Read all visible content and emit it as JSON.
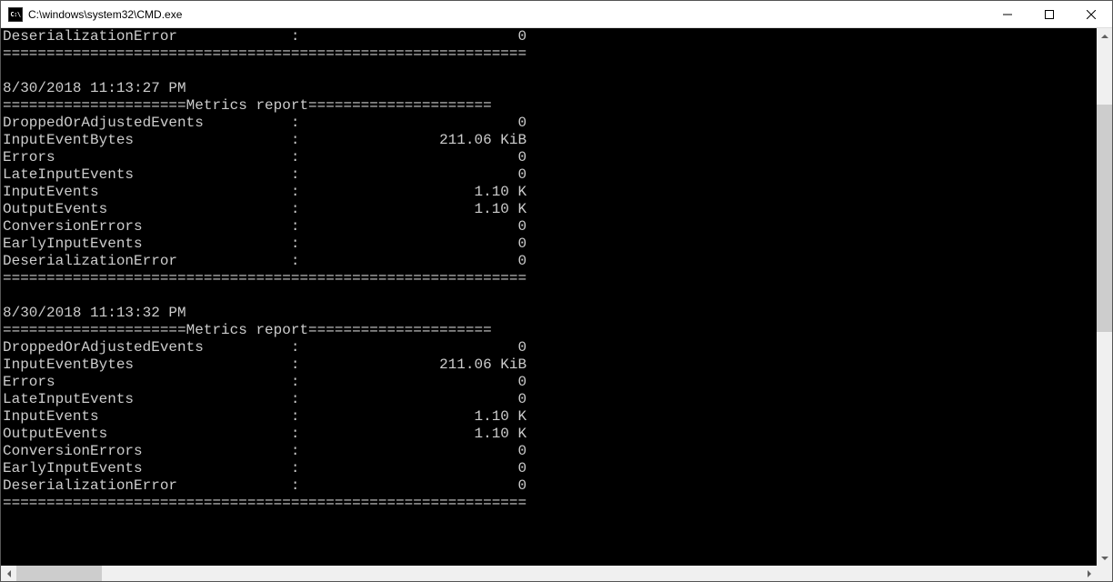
{
  "titlebar": {
    "icon_text": "C:\\",
    "title": "C:\\windows\\system32\\CMD.exe"
  },
  "console": {
    "partial_top": {
      "metric": "DeserializationError",
      "value": "0"
    },
    "sections": [
      {
        "timestamp": "8/30/2018 11:13:27 PM",
        "header": "Metrics report",
        "metrics": [
          {
            "name": "DroppedOrAdjustedEvents",
            "value": "0"
          },
          {
            "name": "InputEventBytes",
            "value": "211.06 KiB"
          },
          {
            "name": "Errors",
            "value": "0"
          },
          {
            "name": "LateInputEvents",
            "value": "0"
          },
          {
            "name": "InputEvents",
            "value": "1.10 K"
          },
          {
            "name": "OutputEvents",
            "value": "1.10 K"
          },
          {
            "name": "ConversionErrors",
            "value": "0"
          },
          {
            "name": "EarlyInputEvents",
            "value": "0"
          },
          {
            "name": "DeserializationError",
            "value": "0"
          }
        ]
      },
      {
        "timestamp": "8/30/2018 11:13:32 PM",
        "header": "Metrics report",
        "metrics": [
          {
            "name": "DroppedOrAdjustedEvents",
            "value": "0"
          },
          {
            "name": "InputEventBytes",
            "value": "211.06 KiB"
          },
          {
            "name": "Errors",
            "value": "0"
          },
          {
            "name": "LateInputEvents",
            "value": "0"
          },
          {
            "name": "InputEvents",
            "value": "1.10 K"
          },
          {
            "name": "OutputEvents",
            "value": "1.10 K"
          },
          {
            "name": "ConversionErrors",
            "value": "0"
          },
          {
            "name": "EarlyInputEvents",
            "value": "0"
          },
          {
            "name": "DeserializationError",
            "value": "0"
          }
        ]
      }
    ],
    "layout": {
      "name_col_width": 33,
      "value_col_width": 25,
      "divider_width": 60,
      "header_prefix_eq": 21,
      "header_suffix_eq": 21
    }
  }
}
